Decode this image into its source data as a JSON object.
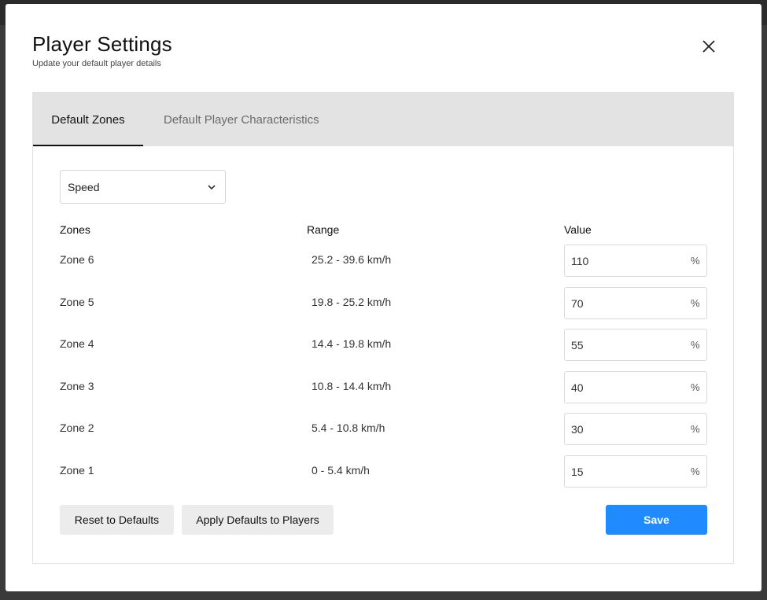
{
  "modal": {
    "title": "Player Settings",
    "subtitle": "Update your default player details"
  },
  "tabs": [
    {
      "label": "Default Zones",
      "active": true
    },
    {
      "label": "Default Player Characteristics",
      "active": false
    }
  ],
  "metric_select": {
    "value": "Speed"
  },
  "table": {
    "headers": {
      "zones": "Zones",
      "range": "Range",
      "value": "Value"
    },
    "rows": [
      {
        "zone": "Zone 6",
        "range": "25.2 - 39.6 km/h",
        "value": "110",
        "unit": "%"
      },
      {
        "zone": "Zone 5",
        "range": "19.8 - 25.2 km/h",
        "value": "70",
        "unit": "%"
      },
      {
        "zone": "Zone 4",
        "range": "14.4 - 19.8 km/h",
        "value": "55",
        "unit": "%"
      },
      {
        "zone": "Zone 3",
        "range": "10.8 - 14.4 km/h",
        "value": "40",
        "unit": "%"
      },
      {
        "zone": "Zone 2",
        "range": "5.4 - 10.8 km/h",
        "value": "30",
        "unit": "%"
      },
      {
        "zone": "Zone 1",
        "range": "0 - 5.4 km/h",
        "value": "15",
        "unit": "%"
      }
    ]
  },
  "buttons": {
    "reset": "Reset to Defaults",
    "apply": "Apply Defaults to Players",
    "save": "Save"
  },
  "colors": {
    "primary": "#1f8bff",
    "tab_bar": "#e3e3e3",
    "secondary_button": "#ececec"
  },
  "icons": {
    "close": "close-icon",
    "dropdown": "chevron-down-icon"
  }
}
